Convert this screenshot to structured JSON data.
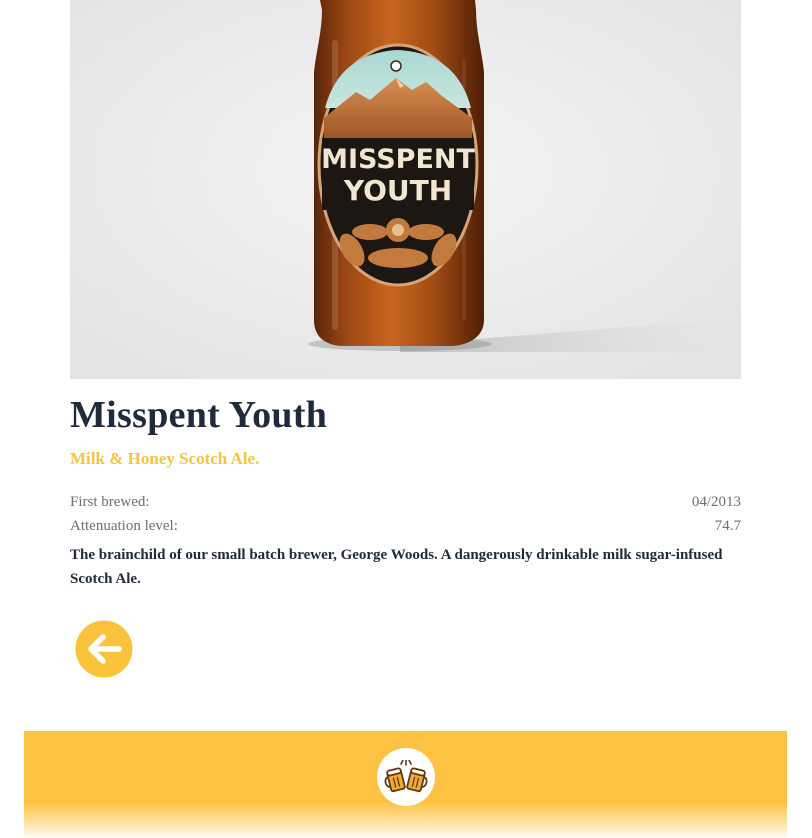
{
  "beer": {
    "name": "Misspent Youth",
    "tagline": "Milk & Honey Scotch Ale.",
    "first_brewed_label": "First brewed:",
    "first_brewed_value": "04/2013",
    "attenuation_label": "Attenuation level:",
    "attenuation_value": "74.7",
    "description": "The brainchild of our small batch brewer, George Woods. A dangerously drinkable milk sugar-infused Scotch Ale."
  },
  "image": {
    "label_line1": "MISSPENT",
    "label_line2": "YOUTH",
    "icon": "beer-bottle-image"
  },
  "nav": {
    "back_icon": "arrow-left-circle-icon"
  },
  "footer": {
    "logo_icon": "cheers-mugs-icon"
  },
  "colors": {
    "accent": "#f8c341",
    "footer_bg": "#fec242",
    "heading": "#1f2a3a",
    "muted": "#6f6f6f"
  }
}
